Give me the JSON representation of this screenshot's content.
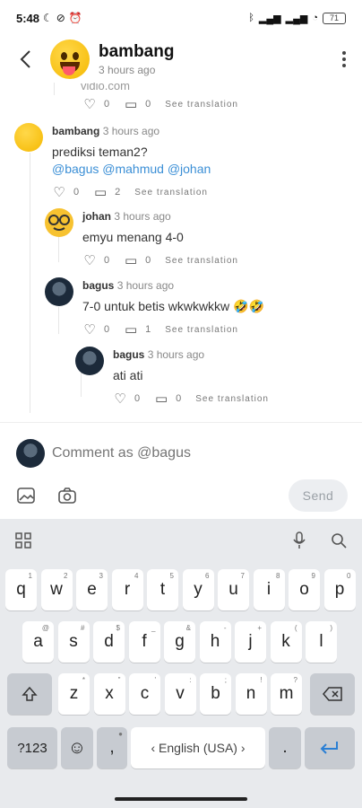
{
  "status_bar": {
    "time": "5:48",
    "battery": "71"
  },
  "header": {
    "name": "bambang",
    "time": "3 hours ago",
    "back_label": "‹"
  },
  "thread": {
    "cut_off_text": "vidio.com",
    "top_actions": {
      "likes": "0",
      "replies": "0",
      "translate": "See translation"
    },
    "comments": [
      {
        "user": "bambang",
        "time": "3 hours ago",
        "text": "prediksi teman2?",
        "mentions": "@bagus @mahmud @johan",
        "likes": "0",
        "replies": "2",
        "translate": "See translation"
      },
      {
        "user": "johan",
        "time": "3 hours ago",
        "text": "emyu menang 4-0",
        "likes": "0",
        "replies": "0",
        "translate": "See translation"
      },
      {
        "user": "bagus",
        "time": "3 hours ago",
        "text": "7-0 untuk betis wkwkwkkw 🤣🤣",
        "likes": "0",
        "replies": "1",
        "translate": "See translation"
      },
      {
        "user": "bagus",
        "time": "3 hours ago",
        "text": "ati ati",
        "likes": "0",
        "replies": "0",
        "translate": "See translation"
      }
    ]
  },
  "composer": {
    "placeholder": "Comment as @bagus",
    "send_label": "Send"
  },
  "keyboard": {
    "row1": [
      "q",
      "w",
      "e",
      "r",
      "t",
      "y",
      "u",
      "i",
      "o",
      "p"
    ],
    "row1_hints": [
      "1",
      "2",
      "3",
      "4",
      "5",
      "6",
      "7",
      "8",
      "9",
      "0"
    ],
    "row2": [
      "a",
      "s",
      "d",
      "f",
      "g",
      "h",
      "j",
      "k",
      "l"
    ],
    "row2_hints": [
      "@",
      "#",
      "$",
      "_",
      "&",
      "-",
      "+",
      "(",
      ")"
    ],
    "row3": [
      "z",
      "x",
      "c",
      "v",
      "b",
      "n",
      "m"
    ],
    "row3_hints": [
      "*",
      "\"",
      "'",
      ":",
      ";",
      "!",
      "?"
    ],
    "symbols_label": "?123",
    "comma": ",",
    "space_label": "‹ English (USA) ›",
    "period": "."
  },
  "colors": {
    "accent": "#3b8fd6",
    "keyboard_bg": "#e8eaed",
    "send_bg": "#eceef1"
  }
}
